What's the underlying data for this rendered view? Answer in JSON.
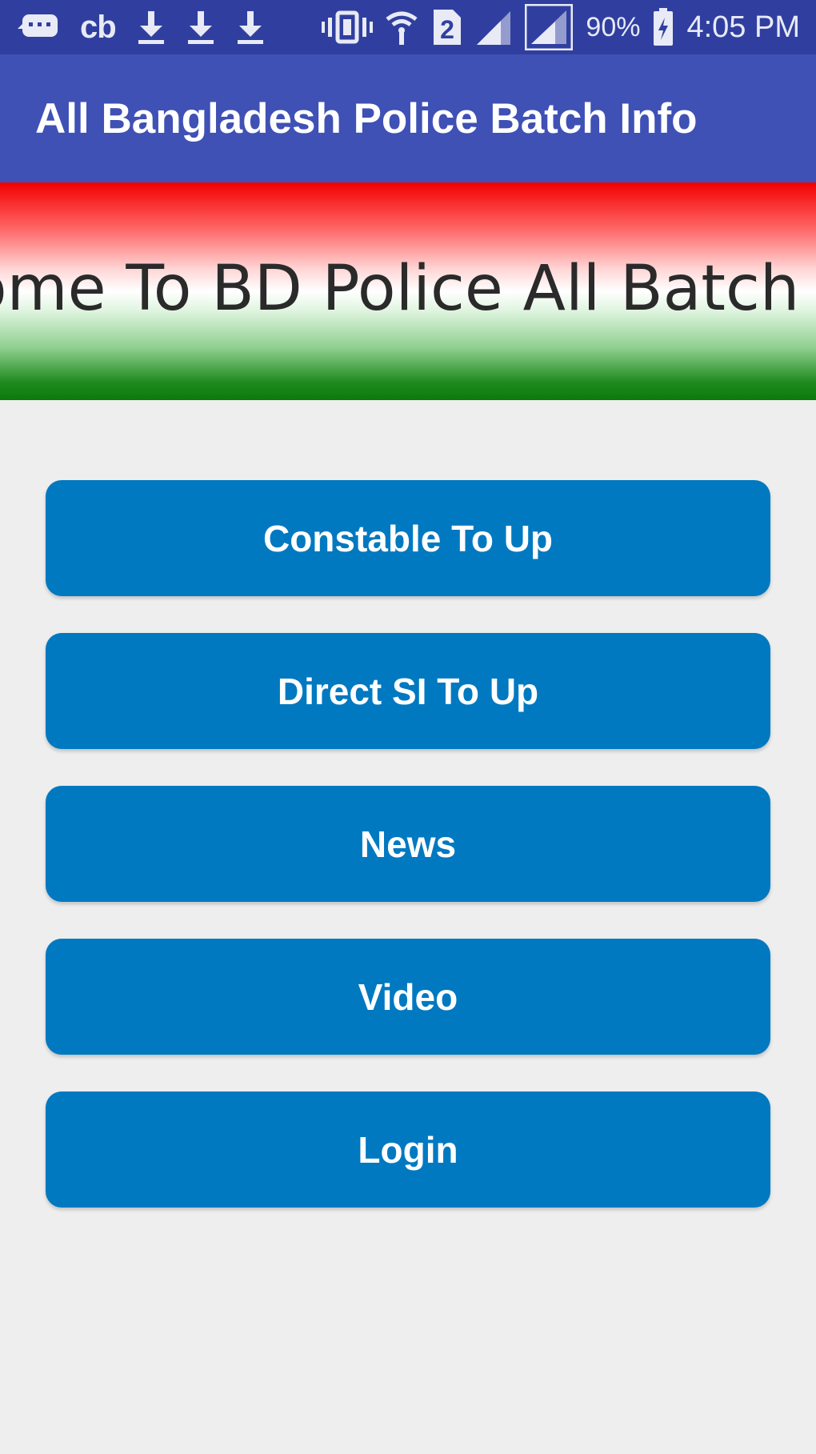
{
  "status_bar": {
    "carrier_label": "cb",
    "sim_badge": "2",
    "battery": "90%",
    "time": "4:05 PM"
  },
  "app_bar": {
    "title": "All Bangladesh Police Batch Info"
  },
  "banner": {
    "text": "come To BD Police All Batch"
  },
  "menu": {
    "buttons": [
      {
        "label": "Constable To Up"
      },
      {
        "label": "Direct SI To Up"
      },
      {
        "label": "News"
      },
      {
        "label": "Video"
      },
      {
        "label": "Login"
      }
    ]
  },
  "colors": {
    "status_bar": "#303f9f",
    "app_bar": "#3f51b5",
    "button": "#0079c1",
    "background": "#eeeeee"
  }
}
